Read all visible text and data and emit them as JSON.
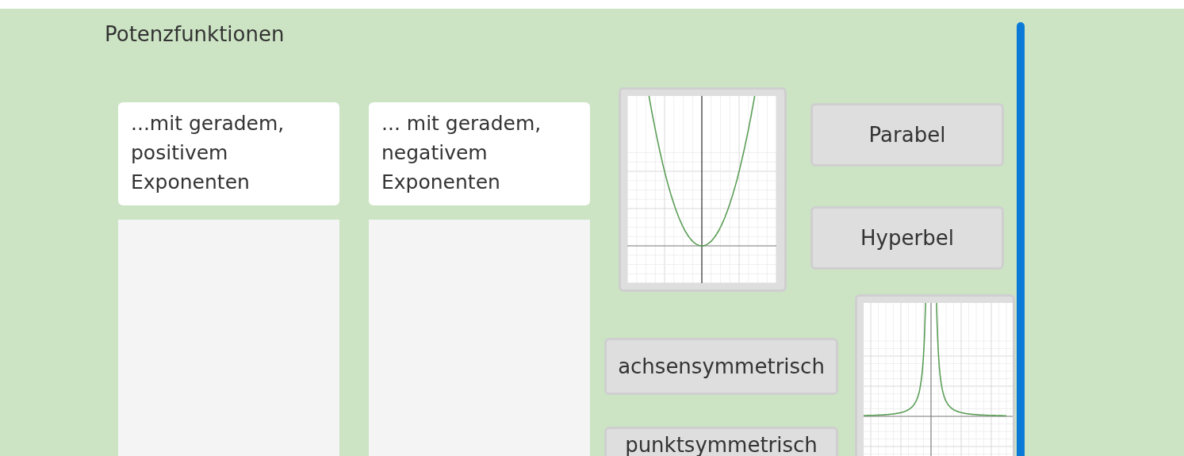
{
  "title": "Potenzfunktionen",
  "categories": [
    {
      "label": "...mit geradem, positivem Exponenten"
    },
    {
      "label": "... mit geradem, negativem Exponenten"
    }
  ],
  "pool": [
    {
      "kind": "parabola-graph"
    },
    {
      "kind": "label",
      "label": "Parabel"
    },
    {
      "kind": "label",
      "label": "Hyperbel"
    },
    {
      "kind": "hyperbola-graph"
    },
    {
      "kind": "label",
      "label": "achsensymmetrisch"
    },
    {
      "kind": "label",
      "label": "punktsymmetrisch"
    }
  ]
}
